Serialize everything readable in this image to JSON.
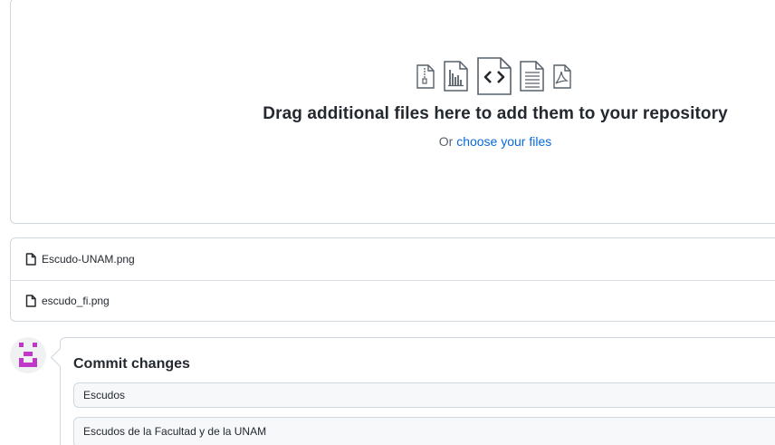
{
  "upload": {
    "title": "Drag additional files here to add them to your repository",
    "subtitle_prefix": "Or ",
    "subtitle_link": "choose your files",
    "icons": [
      "file-zip-icon",
      "file-chart-icon",
      "file-code-icon",
      "file-text-icon",
      "file-pdf-icon"
    ]
  },
  "files": [
    {
      "name": "Escudo-UNAM.png",
      "icon": "file-icon"
    },
    {
      "name": "escudo_fi.png",
      "icon": "file-icon"
    }
  ],
  "commit": {
    "title": "Commit changes",
    "summary_value": "Escudos",
    "description_value": "Escudos de la Facultad y de la UNAM"
  },
  "colors": {
    "link": "#0969da",
    "border": "#d0d7de",
    "avatar": "#c038c8"
  }
}
